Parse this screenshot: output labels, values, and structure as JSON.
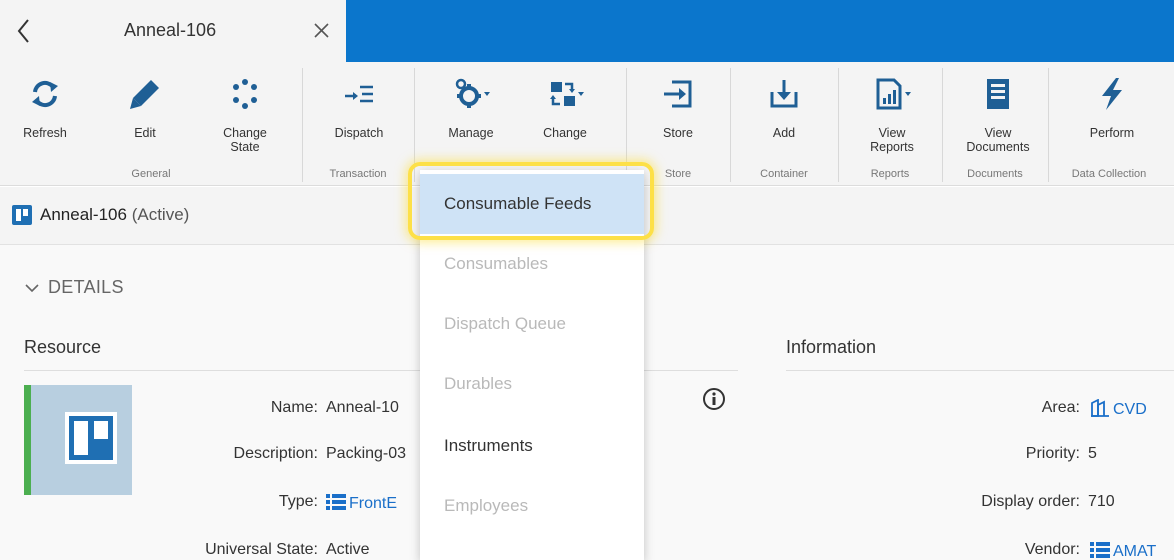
{
  "tab": {
    "title": "Anneal-106"
  },
  "toolbar": {
    "buttons": [
      {
        "label": "Refresh",
        "icon": "refresh-icon"
      },
      {
        "label": "Edit",
        "icon": "pencil-icon"
      },
      {
        "label": "Change\nState",
        "icon": "change-state-icon"
      },
      {
        "label": "Dispatch",
        "icon": "dispatch-icon"
      },
      {
        "label": "Manage",
        "icon": "gears-icon"
      },
      {
        "label": "Change",
        "icon": "swap-icon"
      },
      {
        "label": "Store",
        "icon": "store-icon"
      },
      {
        "label": "Add",
        "icon": "download-tray-icon"
      },
      {
        "label": "View\nReports",
        "icon": "report-chart-icon"
      },
      {
        "label": "View\nDocuments",
        "icon": "document-icon"
      },
      {
        "label": "Perform",
        "icon": "lightning-icon"
      }
    ],
    "groups": [
      "General",
      "Transaction",
      "Store",
      "Container",
      "Reports",
      "Documents",
      "Data Collection"
    ]
  },
  "entity": {
    "name": "Anneal-106",
    "status": "(Active)"
  },
  "details": {
    "label": "DETAILS",
    "resource_heading": "Resource",
    "information_heading": "Information",
    "resource": {
      "name_label": "Name:",
      "name_value": "Anneal-10",
      "description_label": "Description:",
      "description_value": "Packing-03",
      "type_label": "Type:",
      "type_value": "FrontE",
      "universal_state_label": "Universal State:",
      "universal_state_value": "Active"
    },
    "information": {
      "area_label": "Area:",
      "area_value": "CVD",
      "priority_label": "Priority:",
      "priority_value": "5",
      "display_order_label": "Display order:",
      "display_order_value": "710",
      "vendor_label": "Vendor:",
      "vendor_value": "AMAT"
    }
  },
  "manage_menu": {
    "items": [
      {
        "label": "Consumable Feeds",
        "state": "selected"
      },
      {
        "label": "Consumables",
        "state": "disabled"
      },
      {
        "label": "Dispatch Queue",
        "state": "disabled"
      },
      {
        "label": "Durables",
        "state": "disabled"
      },
      {
        "label": "Instruments",
        "state": "enabled"
      },
      {
        "label": "Employees",
        "state": "disabled"
      }
    ]
  },
  "colors": {
    "tabbar": "#0b76cc",
    "accent": "#1a6fc9",
    "highlight": "#fde047",
    "status_green": "#4caf50"
  }
}
